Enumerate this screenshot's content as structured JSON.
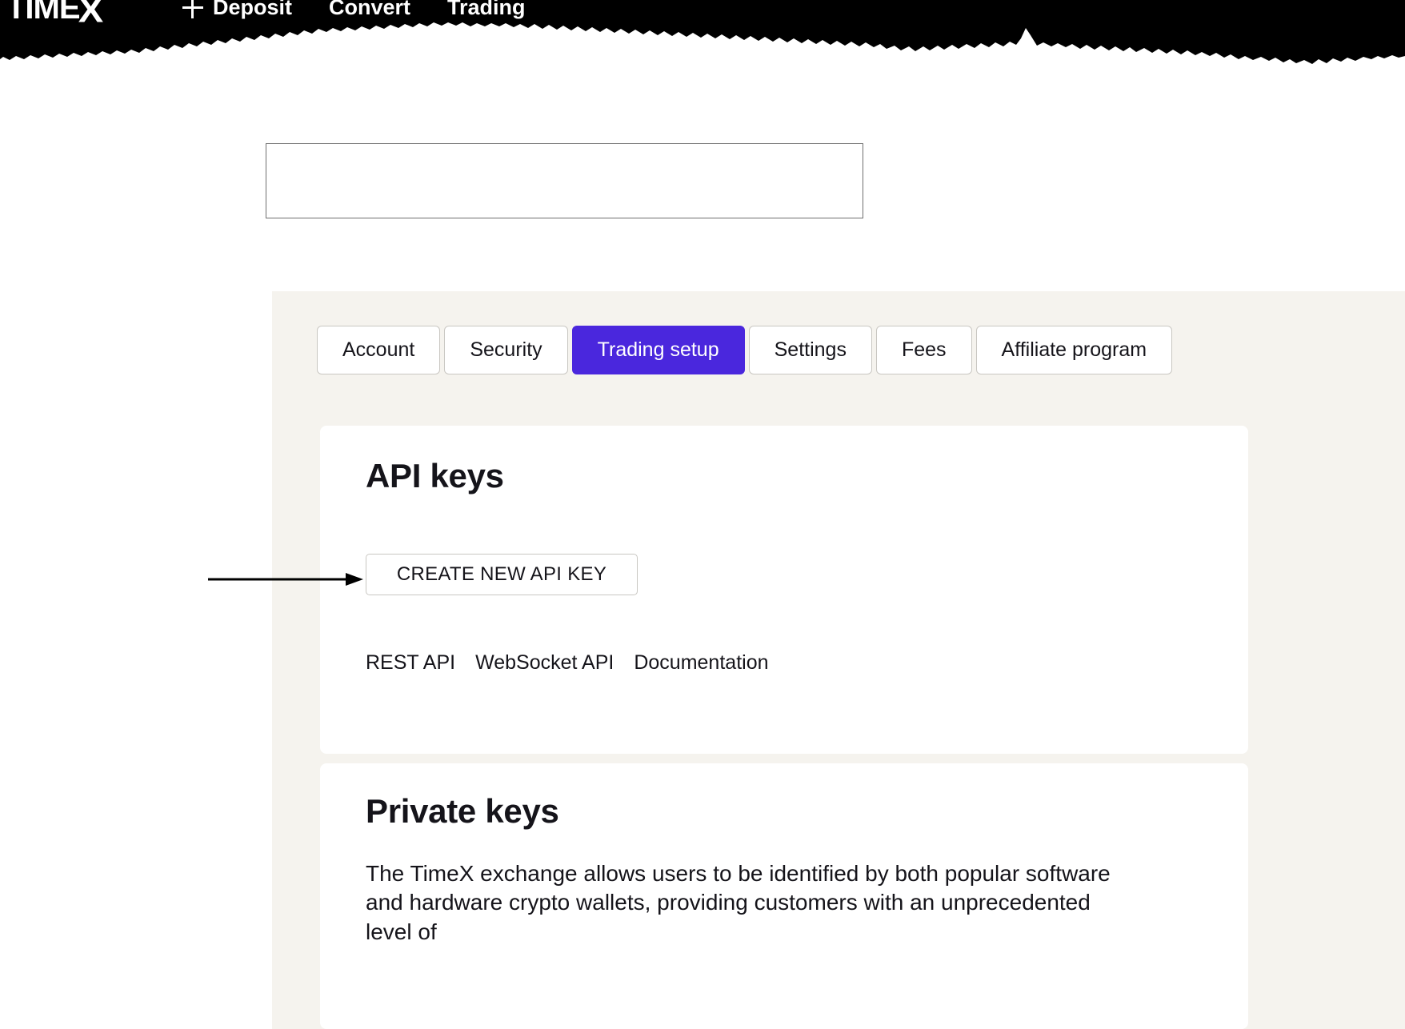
{
  "header": {
    "logo_text": "TIME",
    "logo_accent": "X",
    "nav": [
      {
        "label": "Deposit",
        "icon": "plus-icon"
      },
      {
        "label": "Convert",
        "icon": ""
      },
      {
        "label": "Trading",
        "icon": ""
      }
    ]
  },
  "placeholder": {
    "value": ""
  },
  "tabs": [
    {
      "label": "Account",
      "active": false
    },
    {
      "label": "Security",
      "active": false
    },
    {
      "label": "Trading setup",
      "active": true
    },
    {
      "label": "Settings",
      "active": false
    },
    {
      "label": "Fees",
      "active": false
    },
    {
      "label": "Affiliate program",
      "active": false
    }
  ],
  "api_keys": {
    "title": "API keys",
    "create_button": "CREATE NEW API KEY",
    "links": [
      {
        "label": "REST API"
      },
      {
        "label": "WebSocket API"
      },
      {
        "label": "Documentation"
      }
    ]
  },
  "private_keys": {
    "title": "Private keys",
    "body": "The TimeX exchange allows users to be identified by both popular software and hardware crypto wallets, providing customers with an unprecedented level of"
  },
  "annotation": {
    "arrow_name": "pointer-arrow",
    "target": "CREATE NEW API KEY"
  },
  "colors": {
    "accent_purple": "#4a27dd",
    "panel_beige": "#f5f3ee",
    "header_black": "#000000",
    "text_dark": "#15141a",
    "border_gray": "#c9c7c2"
  }
}
